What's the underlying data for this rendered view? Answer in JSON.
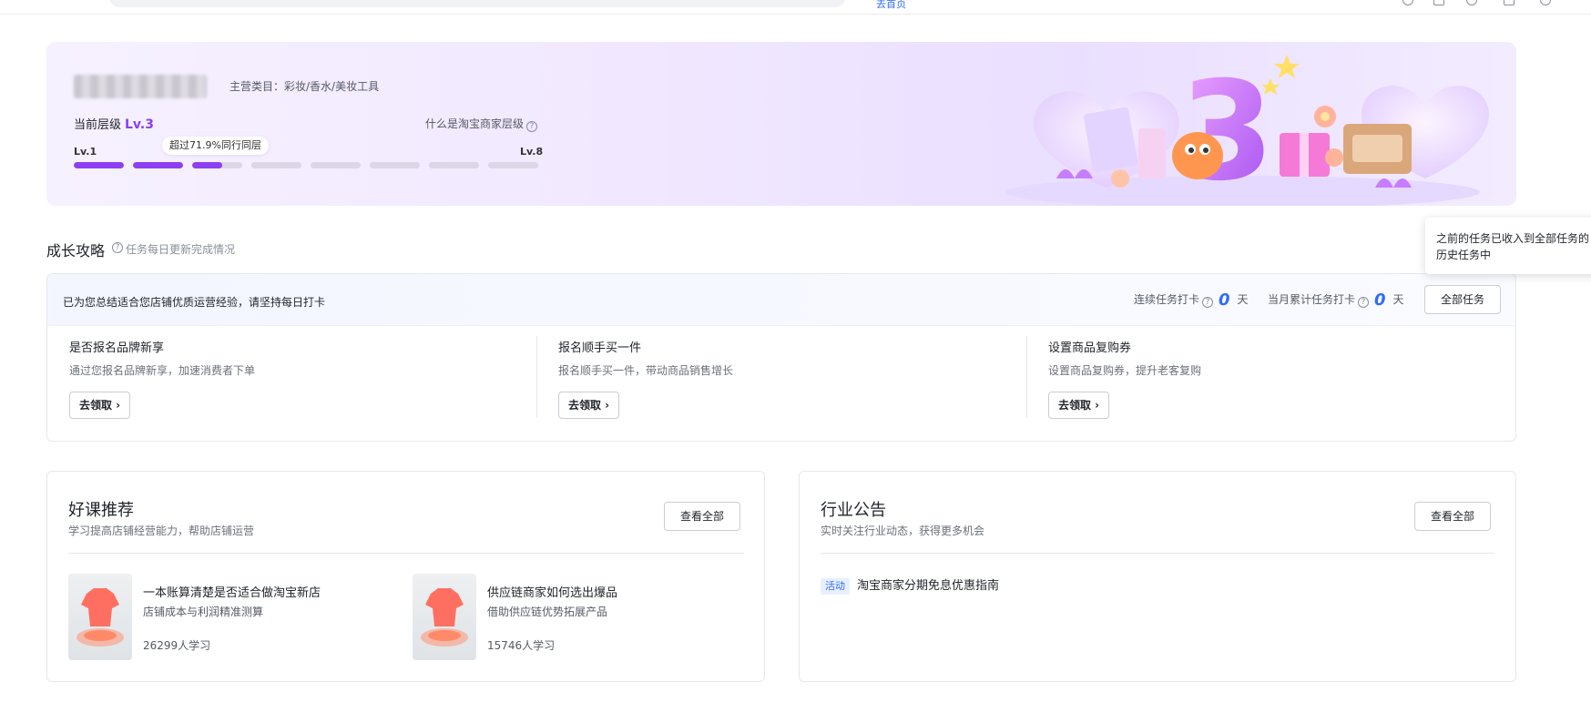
{
  "colors": {
    "accent": "#8d3ff2",
    "link_blue": "#2f6bff",
    "text": "#1f2329"
  },
  "topbar": {
    "hint": "去首页"
  },
  "hero": {
    "category_label": "主营类目：彩妆/香水/美妆工具",
    "current_level_label": "当前层级",
    "current_level_value": "Lv.3",
    "what_is_level": "什么是淘宝商家层级",
    "level_min": "Lv.1",
    "level_max": "Lv.8",
    "exceed_tip": "超过71.9%同行同层",
    "progress": [
      1,
      1,
      0.6,
      0,
      0,
      0,
      0,
      0
    ]
  },
  "growth": {
    "title": "成长攻略",
    "subtitle": "任务每日更新完成情况",
    "tooltip": "之前的任务已收入到全部任务的历史任务中",
    "banner_msg": "已为您总结适合您店铺优质运营经验，请坚持每日打卡",
    "streak_label": "连续任务打卡",
    "streak_value": "0",
    "month_label": "当月累计任务打卡",
    "month_value": "0",
    "day_unit": "天",
    "all_tasks_btn": "全部任务",
    "tasks": [
      {
        "title": "是否报名品牌新享",
        "desc": "通过您报名品牌新享，加速消费者下单",
        "btn": "去领取 ›"
      },
      {
        "title": "报名顺手买一件",
        "desc": "报名顺手买一件，带动商品销售增长",
        "btn": "去领取 ›"
      },
      {
        "title": "设置商品复购券",
        "desc": "设置商品复购券，提升老客复购",
        "btn": "去领取 ›"
      }
    ]
  },
  "courses": {
    "title": "好课推荐",
    "subtitle": "学习提高店铺经营能力，帮助店铺运营",
    "view_all": "查看全部",
    "items": [
      {
        "title": "一本账算清楚是否适合做淘宝新店",
        "desc": "店铺成本与利润精准测算",
        "learners": "26299人学习"
      },
      {
        "title": "供应链商家如何选出爆品",
        "desc": "借助供应链优势拓展产品",
        "learners": "15746人学习"
      }
    ]
  },
  "notices": {
    "title": "行业公告",
    "subtitle": "实时关注行业动态，获得更多机会",
    "view_all": "查看全部",
    "items": [
      {
        "tag": "活动",
        "text": "淘宝商家分期免息优惠指南"
      }
    ]
  }
}
